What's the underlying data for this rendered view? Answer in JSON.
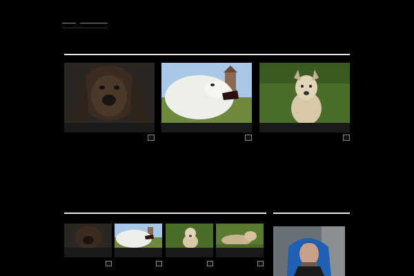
{
  "colors": {
    "background": "#000000",
    "accent_link": "#4aa3df",
    "rule": "#e8e8e8",
    "caption_bg": "#1a1a1a"
  },
  "nav": [
    {
      "label": ""
    },
    {
      "label": ""
    },
    {
      "label": ""
    },
    {
      "label": ""
    },
    {
      "label": ""
    },
    {
      "label": ""
    }
  ],
  "interesting": {
    "title": "",
    "cards": [
      {
        "caption": "",
        "date": "",
        "excerpt": "",
        "more": ""
      },
      {
        "caption": "",
        "date": "",
        "excerpt": "",
        "more": ""
      },
      {
        "caption": "",
        "date": "",
        "excerpt": "",
        "more": ""
      }
    ]
  },
  "news": {
    "title": "",
    "items": [
      {
        "caption": "",
        "date": "",
        "excerpt": ""
      },
      {
        "caption": "",
        "date": "",
        "excerpt": ""
      },
      {
        "caption": "",
        "date": "",
        "excerpt": ""
      },
      {
        "caption": "",
        "date": "",
        "excerpt": ""
      }
    ]
  },
  "sidebar": {
    "title": "",
    "subtitle": ""
  }
}
